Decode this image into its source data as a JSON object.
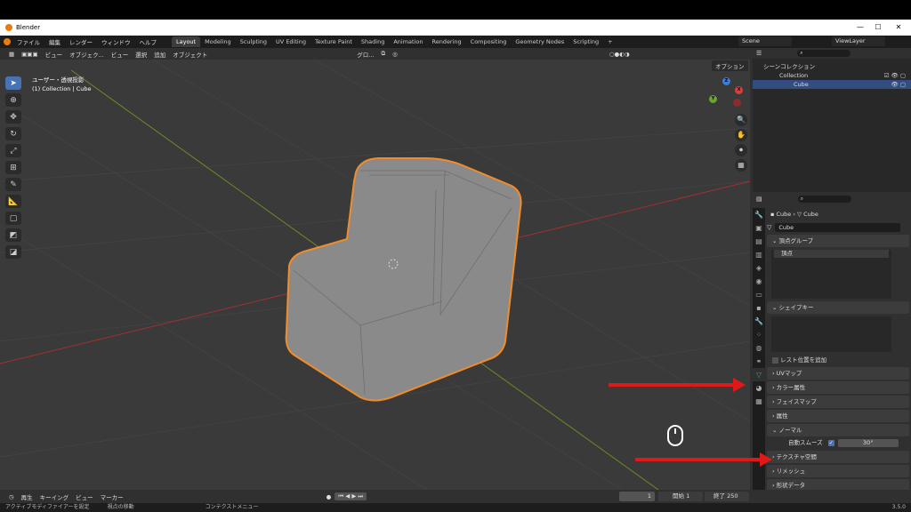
{
  "app": {
    "title": "Blender",
    "version": "3.5.0"
  },
  "menu": [
    "ファイル",
    "編集",
    "レンダー",
    "ウィンドウ",
    "ヘルプ"
  ],
  "workspaces": [
    "Layout",
    "Modeling",
    "Sculpting",
    "UV Editing",
    "Texture Paint",
    "Shading",
    "Animation",
    "Rendering",
    "Compositing",
    "Geometry Nodes",
    "Scripting"
  ],
  "active_workspace": "Layout",
  "scene": "Scene",
  "view_layer": "ViewLayer",
  "viewport_header": {
    "mode": "オブジェク...",
    "view": "ビュー",
    "select": "選択",
    "add": "追加",
    "object": "オブジェクト",
    "transform": "グロ...",
    "options": "オプション"
  },
  "viewport_info": {
    "line1": "ユーザー・透視投影",
    "line2": "(1) Collection | Cube"
  },
  "outliner": {
    "scene_collection": "シーンコレクション",
    "collection": "Collection",
    "object": "Cube"
  },
  "properties": {
    "breadcrumb_obj": "Cube",
    "breadcrumb_mesh": "Cube",
    "mesh_name": "Cube",
    "vertex_groups_title": "頂点グループ",
    "vertex_group_item": "頂点",
    "shape_keys_title": "シェイプキー",
    "rest_position": "レスト位置を追加",
    "uv_maps": "UVマップ",
    "color_attrs": "カラー属性",
    "face_maps": "フェイスマップ",
    "attributes": "属性",
    "normals": "ノーマル",
    "auto_smooth_label": "自動スムーズ",
    "auto_smooth_angle": "30°",
    "texture_space": "テクスチャ空間",
    "remesh": "リメッシュ",
    "geometry_data": "形状データ"
  },
  "timeline": {
    "playback": "再生",
    "keying": "キーイング",
    "view": "ビュー",
    "marker": "マーカー",
    "current": "1",
    "start_label": "開始",
    "start": "1",
    "end_label": "終了",
    "end": "250"
  },
  "status": {
    "left": "アクティブモディファイアーを設定",
    "mid": "視点の移動",
    "right": "コンテクストメニュー"
  },
  "colors": {
    "accent": "#4772b3",
    "arrow": "#e01818",
    "select_outline": "#f08c2b"
  }
}
